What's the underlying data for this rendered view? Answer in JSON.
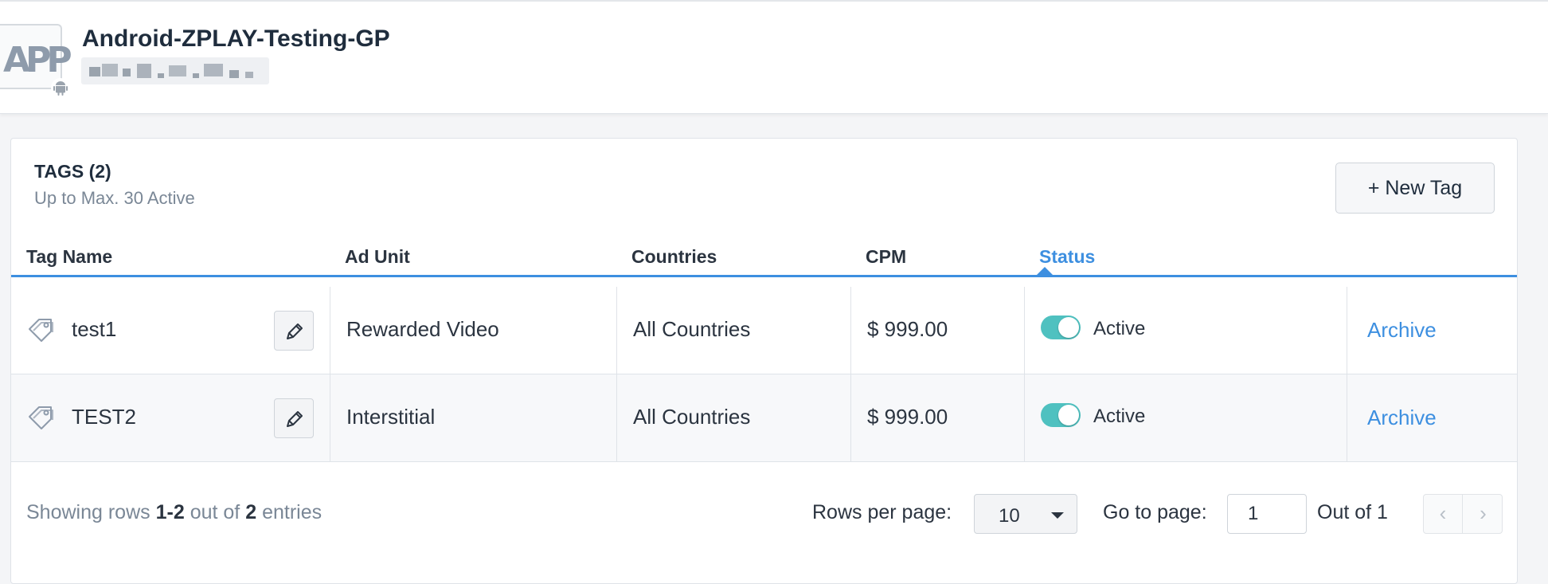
{
  "app": {
    "logo_text": "AP",
    "logo_text2": "P",
    "name": "Android-ZPLAY-Testing-GP",
    "platform_icon": "android-icon"
  },
  "tags": {
    "title": "TAGS (2)",
    "subtitle": "Up to Max. 30 Active",
    "new_button": "+ New Tag",
    "columns": [
      "Tag Name",
      "Ad Unit",
      "Countries",
      "CPM",
      "Status"
    ],
    "rows": [
      {
        "name": "test1",
        "ad_unit": "Rewarded Video",
        "countries": "All Countries",
        "cpm": "$ 999.00",
        "status": "Active",
        "action": "Archive"
      },
      {
        "name": "TEST2",
        "ad_unit": "Interstitial",
        "countries": "All Countries",
        "cpm": "$ 999.00",
        "status": "Active",
        "action": "Archive"
      }
    ]
  },
  "footer": {
    "showing_prefix": "Showing rows",
    "showing_range": "1-2",
    "showing_mid": "out of",
    "showing_total": "2",
    "showing_suffix": "entries",
    "rows_per_page_label": "Rows per page:",
    "rows_per_page_value": "10",
    "go_to_page_label": "Go to page:",
    "current_page": "1",
    "out_of_label": "Out of 1",
    "prev_icon": "‹",
    "next_icon": "›"
  },
  "colors": {
    "accent": "#3d8fe0",
    "toggle_on": "#4fc1c0"
  }
}
